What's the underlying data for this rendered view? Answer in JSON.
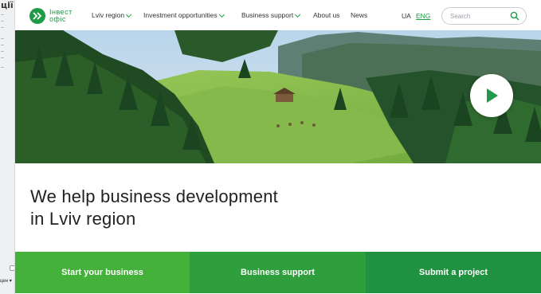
{
  "background_window": {
    "title_fragment": "ції",
    "dropdown_label": "цен"
  },
  "header": {
    "logo": {
      "line1": "Інвест",
      "line2": "офіс"
    },
    "nav": [
      {
        "label": "Lviv region",
        "has_dropdown": true
      },
      {
        "label": "Investment opportunities",
        "has_dropdown": true
      },
      {
        "label": "Business support",
        "has_dropdown": true
      },
      {
        "label": "About us",
        "has_dropdown": false
      },
      {
        "label": "News",
        "has_dropdown": false
      }
    ],
    "languages": {
      "ua": "UA",
      "eng": "ENG",
      "active": "ENG"
    },
    "search": {
      "placeholder": "Search",
      "value": ""
    }
  },
  "hero": {
    "icon": "play-icon"
  },
  "main": {
    "headline_line1": "We help business development",
    "headline_line2": "in Lviv region"
  },
  "cta": [
    {
      "label": "Start your business"
    },
    {
      "label": "Business support"
    },
    {
      "label": "Submit a project"
    }
  ],
  "colors": {
    "brand_green": "#1f9a46",
    "cta_1": "#44b13a",
    "cta_2": "#2f9e3c",
    "cta_3": "#1f9140"
  }
}
